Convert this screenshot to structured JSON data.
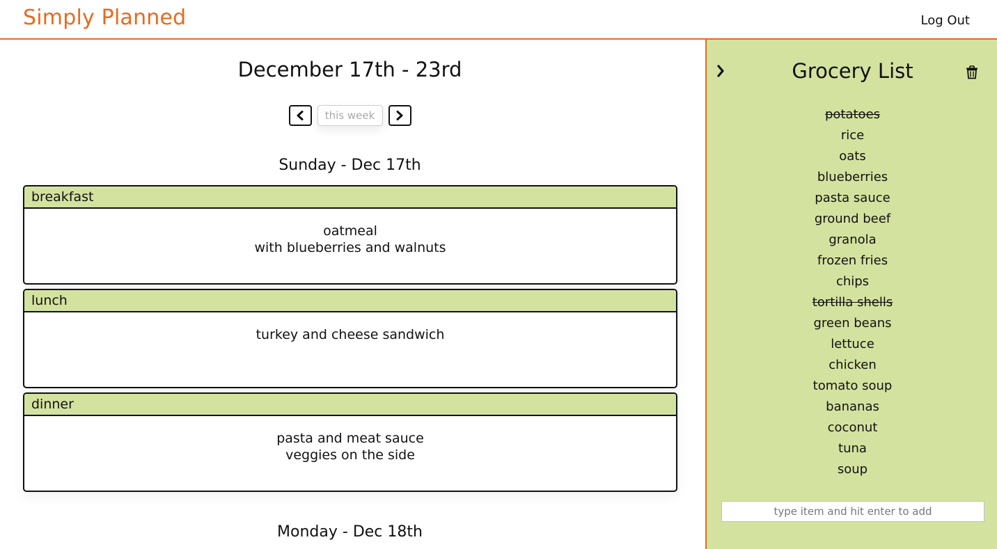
{
  "header": {
    "brand": "Simply Planned",
    "logout_label": "Log Out"
  },
  "planner": {
    "week_title": "December 17th - 23rd",
    "this_week_label": "this week",
    "days": [
      {
        "title": "Sunday - Dec 17th",
        "meals": [
          {
            "name": "breakfast",
            "lines": [
              "oatmeal",
              "with blueberries and walnuts"
            ]
          },
          {
            "name": "lunch",
            "lines": [
              "turkey and cheese sandwich"
            ]
          },
          {
            "name": "dinner",
            "lines": [
              "pasta and meat sauce",
              "veggies on the side"
            ]
          }
        ]
      },
      {
        "title": "Monday - Dec 18th"
      }
    ]
  },
  "grocery": {
    "title": "Grocery List",
    "items": [
      {
        "name": "potatoes",
        "crossed": true
      },
      {
        "name": "rice",
        "crossed": false
      },
      {
        "name": "oats",
        "crossed": false
      },
      {
        "name": "blueberries",
        "crossed": false
      },
      {
        "name": "pasta sauce",
        "crossed": false
      },
      {
        "name": "ground beef",
        "crossed": false
      },
      {
        "name": "granola",
        "crossed": false
      },
      {
        "name": "frozen fries",
        "crossed": false
      },
      {
        "name": "chips",
        "crossed": false
      },
      {
        "name": "tortilla shells",
        "crossed": true
      },
      {
        "name": "green beans",
        "crossed": false
      },
      {
        "name": "lettuce",
        "crossed": false
      },
      {
        "name": "chicken",
        "crossed": false
      },
      {
        "name": "tomato soup",
        "crossed": false
      },
      {
        "name": "bananas",
        "crossed": false
      },
      {
        "name": "coconut",
        "crossed": false
      },
      {
        "name": "tuna",
        "crossed": false
      },
      {
        "name": "soup",
        "crossed": false
      }
    ],
    "add_placeholder": "type item and hit enter to add"
  },
  "colors": {
    "accent": "#e8691e",
    "panel": "#d4e2a0"
  },
  "icons": {
    "prev": "chevron-left-icon",
    "next": "chevron-right-icon",
    "collapse": "chevron-right-icon",
    "clear": "trash-icon"
  }
}
